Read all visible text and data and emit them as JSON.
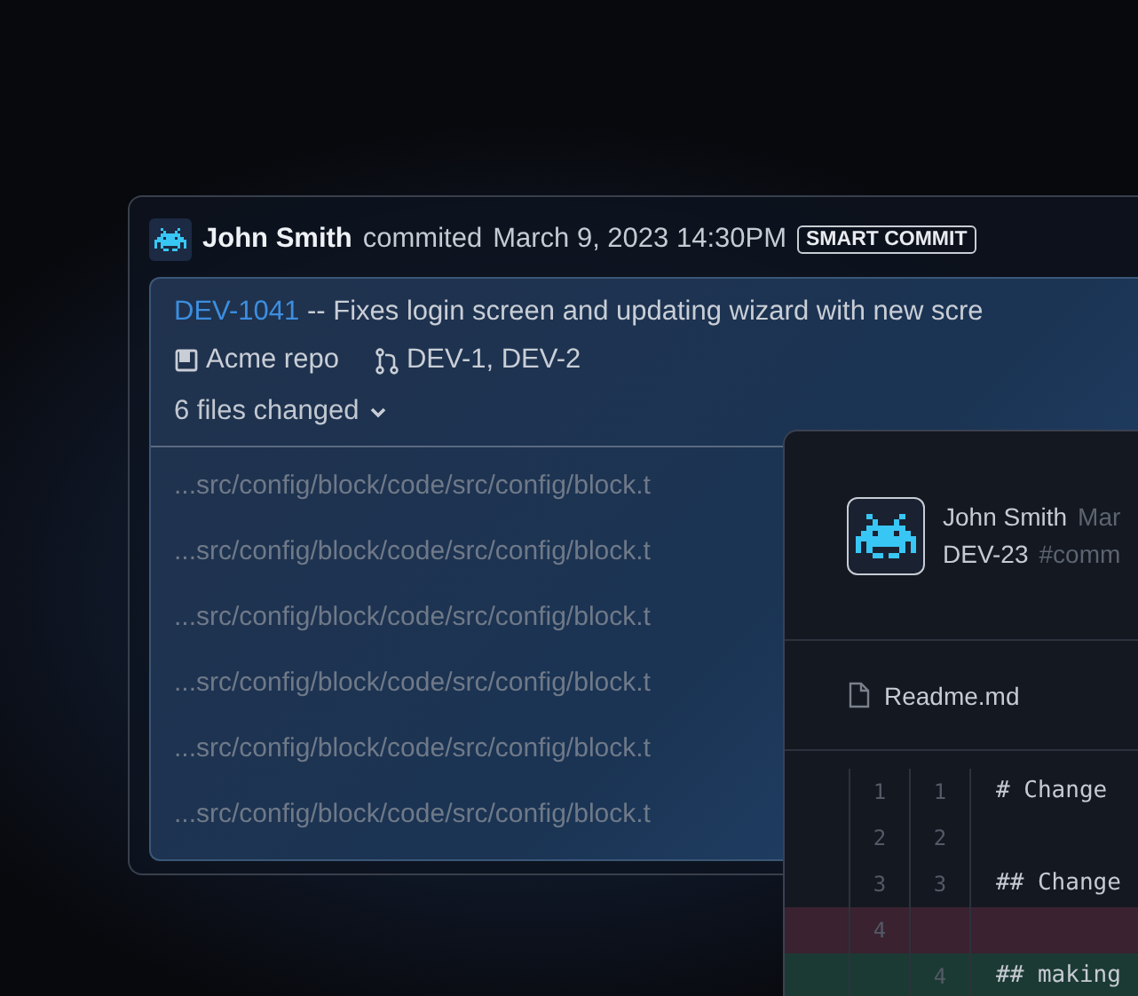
{
  "commit": {
    "author": "John Smith",
    "action": "commited",
    "date": "March 9, 2023 14:30PM",
    "badge": "SMART COMMIT",
    "issue": "DEV-1041",
    "message": "-- Fixes login screen and updating wizard with new scre",
    "repo": "Acme repo",
    "branches": "DEV-1, DEV-2",
    "files_toggle": "6 files changed",
    "expanded": true,
    "files": [
      "...src/config/block/code/src/config/block.t",
      "...src/config/block/code/src/config/block.t",
      "...src/config/block/code/src/config/block.t",
      "...src/config/block/code/src/config/block.t",
      "...src/config/block/code/src/config/block.t",
      "...src/config/block/code/src/config/block.t"
    ]
  },
  "detail": {
    "author": "John Smith",
    "date": "Mar",
    "issue": "DEV-23",
    "tag": "#comm",
    "file": "Readme.md",
    "lines": [
      {
        "kind": "context",
        "old": "1",
        "new": "1",
        "code": "# Change"
      },
      {
        "kind": "context",
        "old": "2",
        "new": "2"
      },
      {
        "kind": "context",
        "old": "3",
        "new": "3",
        "code": "## Change"
      },
      {
        "kind": "removed",
        "old": "4"
      },
      {
        "kind": "added",
        "new": "4",
        "code": "## making"
      }
    ]
  }
}
